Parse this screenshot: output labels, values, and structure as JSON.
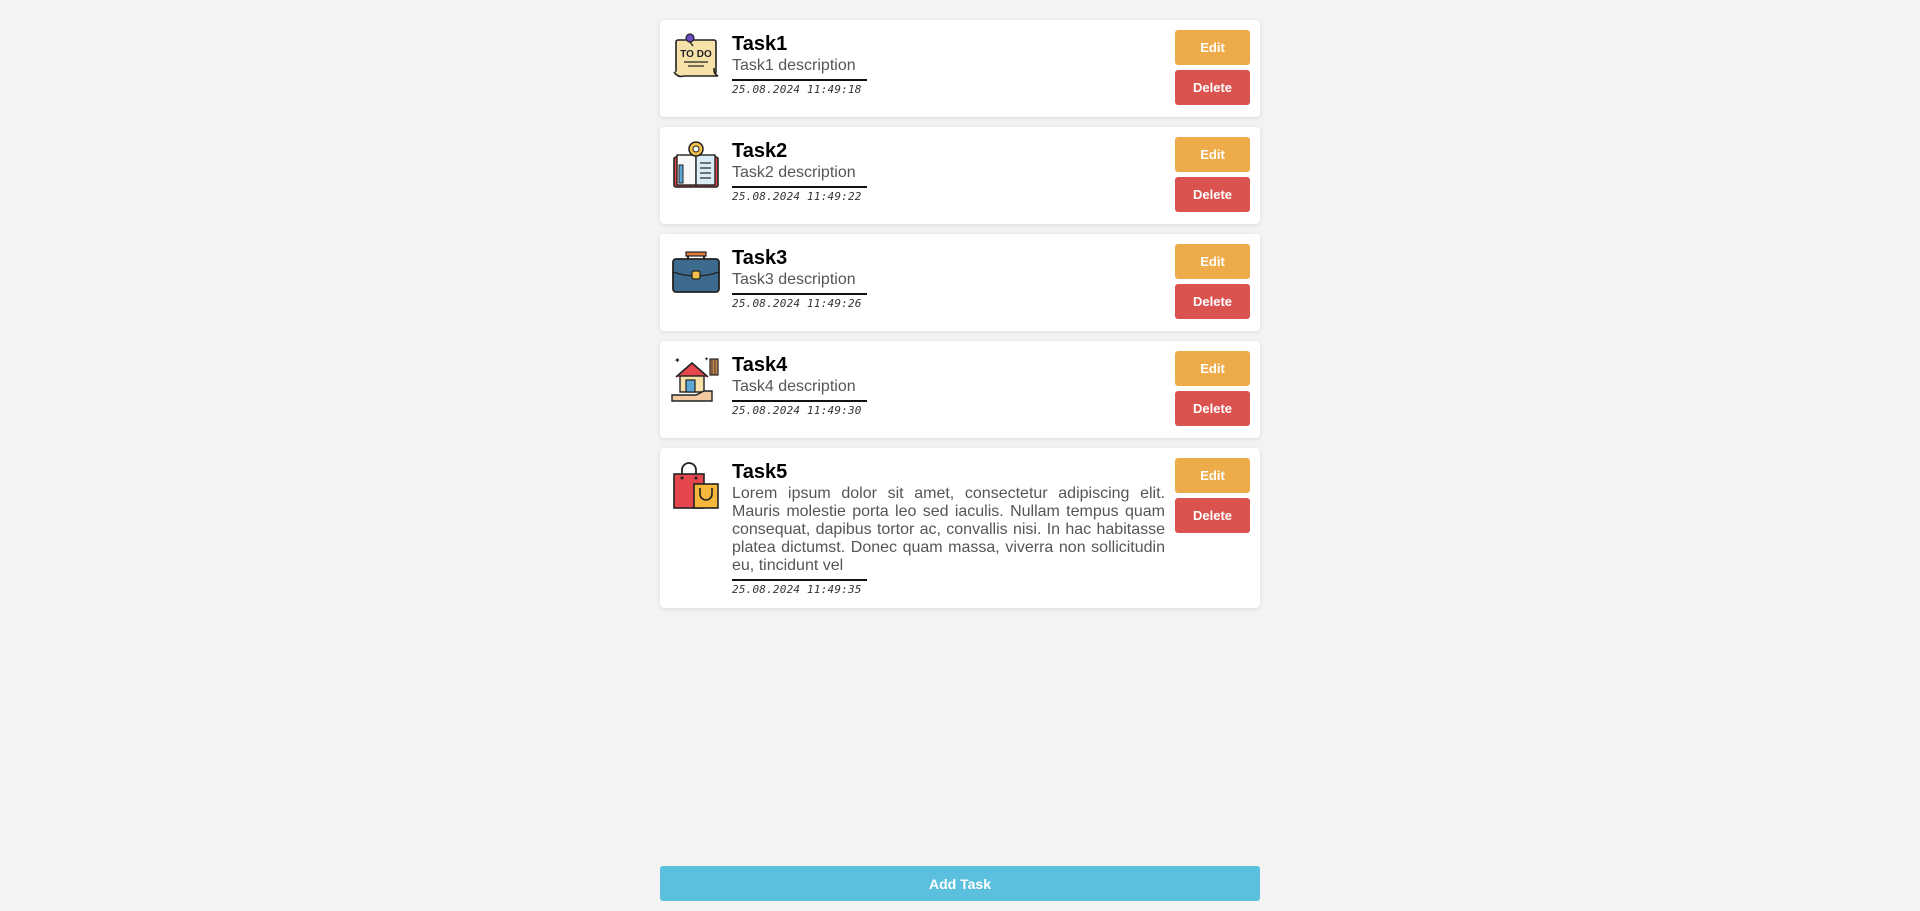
{
  "tasks": [
    {
      "icon": "todo-note-icon",
      "title": "Task1",
      "description": "Task1 description",
      "date": "25.08.2024 11:49:18",
      "edit_label": "Edit",
      "delete_label": "Delete"
    },
    {
      "icon": "study-book-icon",
      "title": "Task2",
      "description": "Task2 description",
      "date": "25.08.2024 11:49:22",
      "edit_label": "Edit",
      "delete_label": "Delete"
    },
    {
      "icon": "briefcase-icon",
      "title": "Task3",
      "description": "Task3 description",
      "date": "25.08.2024 11:49:26",
      "edit_label": "Edit",
      "delete_label": "Delete"
    },
    {
      "icon": "house-cleaning-icon",
      "title": "Task4",
      "description": "Task4 description",
      "date": "25.08.2024 11:49:30",
      "edit_label": "Edit",
      "delete_label": "Delete"
    },
    {
      "icon": "shopping-bags-icon",
      "title": "Task5",
      "description": "Lorem ipsum dolor sit amet, consectetur adipiscing elit. Mauris molestie porta leo sed iaculis. Nullam tempus quam consequat, dapibus tortor ac, convallis nisi. In hac habitasse platea dictumst. Donec quam massa, viverra non sollicitudin eu, tincidunt vel",
      "date": "25.08.2024 11:49:35",
      "edit_label": "Edit",
      "delete_label": "Delete"
    }
  ],
  "add_task_label": "Add Task",
  "colors": {
    "background": "#f3f3f3",
    "edit": "#eeab49",
    "delete": "#da534f",
    "add": "#5bc0de"
  }
}
